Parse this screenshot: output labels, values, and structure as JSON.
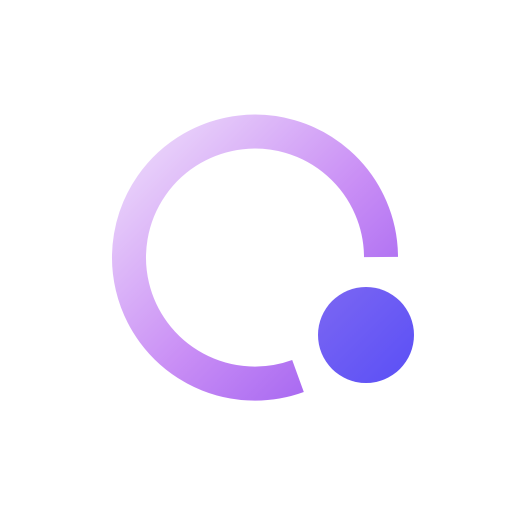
{
  "logo": {
    "icon_name": "ring-with-dot-logo-icon",
    "colors": {
      "background": "#ffffff",
      "ring_light": "#eedcfb",
      "ring_mid": "#c98ef5",
      "ring_dark": "#9d5cf0",
      "dot_light": "#7c67f2",
      "dot_dark": "#5a4ff6"
    }
  }
}
